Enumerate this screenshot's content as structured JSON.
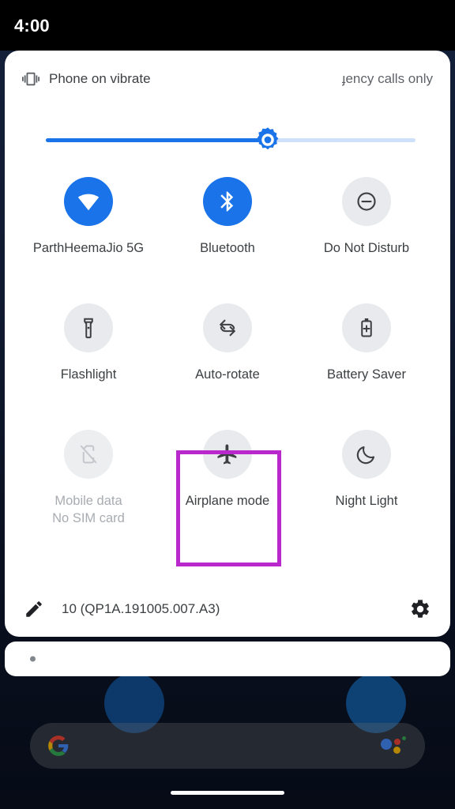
{
  "statusbar": {
    "time": "4:00"
  },
  "quick_settings": {
    "header": {
      "vibrate_icon": "vibrate-icon",
      "left_text": "Phone on vibrate",
      "right_text": "ɟency calls only"
    },
    "brightness": {
      "label": "Brightness",
      "value_percent": 60,
      "icon": "brightness-sun-icon",
      "fill_color": "#1a73e8",
      "track_color": "#cfe0fb"
    },
    "tiles": [
      [
        {
          "label": "ParthHeemaJio 5G",
          "sub": "",
          "icon": "wifi-icon",
          "state": "on",
          "highlighted": false
        },
        {
          "label": "Bluetooth",
          "sub": "",
          "icon": "bluetooth-icon",
          "state": "on",
          "highlighted": false
        },
        {
          "label": "Do Not Disturb",
          "sub": "",
          "icon": "do-not-disturb-icon",
          "state": "off",
          "highlighted": false
        }
      ],
      [
        {
          "label": "Flashlight",
          "sub": "",
          "icon": "flashlight-icon",
          "state": "off",
          "highlighted": false
        },
        {
          "label": "Auto-rotate",
          "sub": "",
          "icon": "auto-rotate-icon",
          "state": "off",
          "highlighted": false
        },
        {
          "label": "Battery Saver",
          "sub": "",
          "icon": "battery-saver-icon",
          "state": "off",
          "highlighted": false
        }
      ],
      [
        {
          "label": "Mobile data",
          "sub": "No SIM card",
          "icon": "no-sim-icon",
          "state": "disabled",
          "highlighted": false
        },
        {
          "label": "Airplane mode",
          "sub": "",
          "icon": "airplane-icon",
          "state": "off",
          "highlighted": true
        },
        {
          "label": "Night Light",
          "sub": "",
          "icon": "night-light-moon-icon",
          "state": "off",
          "highlighted": false
        }
      ]
    ],
    "footer": {
      "edit_icon": "pencil-edit-icon",
      "build_text": "10 (QP1A.191005.007.A3)",
      "settings_icon": "gear-icon"
    },
    "highlight_color": "#b828cd",
    "active_tile_color": "#1a73e8",
    "inactive_tile_color": "#e8eaed"
  },
  "notification_strip": {
    "page_dot": "page-indicator-dot"
  },
  "home_screen": {
    "search_bar": {
      "google_logo": "google-g-icon",
      "assistant_icon": "google-assistant-icon"
    },
    "gesture_bar": "home-gesture-bar"
  }
}
